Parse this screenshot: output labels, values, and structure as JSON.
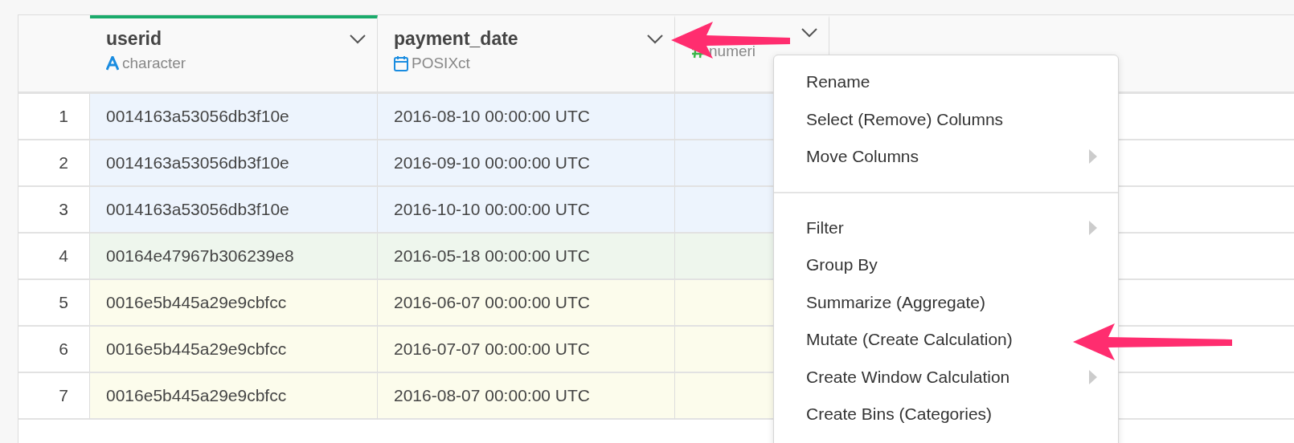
{
  "table": {
    "columns": [
      {
        "name": "userid",
        "type": "character",
        "kind": "character",
        "selected": true
      },
      {
        "name": "payment_date",
        "type": "POSIXct",
        "kind": "date",
        "selected": false
      },
      {
        "type": "numeri",
        "kind": "numeric",
        "selected": false
      }
    ],
    "rows": [
      {
        "index": "1",
        "color": "#edf4fd",
        "cells": [
          "0014163a53056db3f10e",
          "2016-08-10 00:00:00 UTC"
        ]
      },
      {
        "index": "2",
        "color": "#edf4fd",
        "cells": [
          "0014163a53056db3f10e",
          "2016-09-10 00:00:00 UTC"
        ]
      },
      {
        "index": "3",
        "color": "#edf4fd",
        "cells": [
          "0014163a53056db3f10e",
          "2016-10-10 00:00:00 UTC"
        ]
      },
      {
        "index": "4",
        "color": "#eef6ed",
        "cells": [
          "00164e47967b306239e8",
          "2016-05-18 00:00:00 UTC"
        ]
      },
      {
        "index": "5",
        "color": "#fcfcec",
        "cells": [
          "0016e5b445a29e9cbfcc",
          "2016-06-07 00:00:00 UTC"
        ]
      },
      {
        "index": "6",
        "color": "#fcfcec",
        "cells": [
          "0016e5b445a29e9cbfcc",
          "2016-07-07 00:00:00 UTC"
        ]
      },
      {
        "index": "7",
        "color": "#fcfcec",
        "cells": [
          "0016e5b445a29e9cbfcc",
          "2016-08-07 00:00:00 UTC"
        ]
      }
    ]
  },
  "column_menu": {
    "items": [
      {
        "kind": "item",
        "label": "Rename",
        "submenu": false
      },
      {
        "kind": "item",
        "label": "Select (Remove) Columns",
        "submenu": false
      },
      {
        "kind": "item",
        "label": "Move Columns",
        "submenu": true
      },
      {
        "kind": "separator"
      },
      {
        "kind": "item",
        "label": "Filter",
        "submenu": true
      },
      {
        "kind": "item",
        "label": "Group By",
        "submenu": false
      },
      {
        "kind": "item",
        "label": "Summarize (Aggregate)",
        "submenu": false
      },
      {
        "kind": "item",
        "label": "Mutate (Create Calculation)",
        "submenu": false
      },
      {
        "kind": "item",
        "label": "Create Window Calculation",
        "submenu": true
      },
      {
        "kind": "item",
        "label": "Create Bins (Categories)",
        "submenu": false
      }
    ]
  }
}
